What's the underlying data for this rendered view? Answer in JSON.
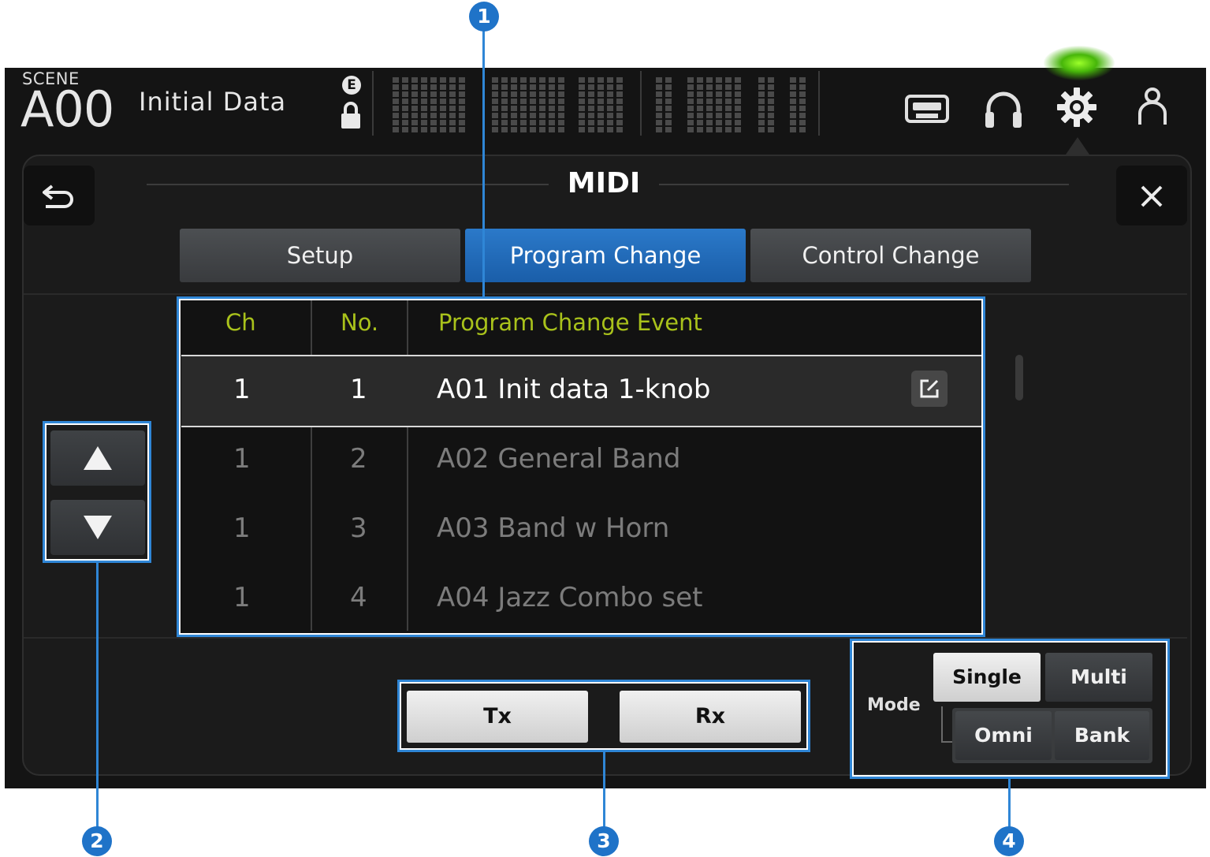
{
  "header": {
    "scene_label": "SCENE",
    "scene_number": "A00",
    "scene_title": "Initial Data",
    "edit_indicator": "E"
  },
  "toolbar_icons": [
    "recorder-icon",
    "headphones-icon",
    "gear-icon",
    "user-icon"
  ],
  "panel": {
    "title": "MIDI",
    "tabs": [
      {
        "label": "Setup",
        "active": false
      },
      {
        "label": "Program Change",
        "active": true
      },
      {
        "label": "Control Change",
        "active": false
      }
    ]
  },
  "table": {
    "headers": {
      "ch": "Ch",
      "no": "No.",
      "event": "Program Change Event"
    },
    "rows": [
      {
        "ch": "1",
        "no": "1",
        "event": "A01 Init data 1-knob",
        "selected": true
      },
      {
        "ch": "1",
        "no": "2",
        "event": "A02 General Band",
        "selected": false
      },
      {
        "ch": "1",
        "no": "3",
        "event": "A03 Band w Horn",
        "selected": false
      },
      {
        "ch": "1",
        "no": "4",
        "event": "A04 Jazz Combo set",
        "selected": false
      }
    ]
  },
  "transfer": {
    "tx_label": "Tx",
    "rx_label": "Rx"
  },
  "mode": {
    "label": "Mode",
    "single_label": "Single",
    "multi_label": "Multi",
    "omni_label": "Omni",
    "bank_label": "Bank",
    "selected": "Single"
  },
  "callouts": [
    "1",
    "2",
    "3",
    "4"
  ],
  "colors": {
    "accent_blue": "#1f73c8",
    "header_green": "#a9c21b",
    "active_tab": "#2b79c9"
  }
}
